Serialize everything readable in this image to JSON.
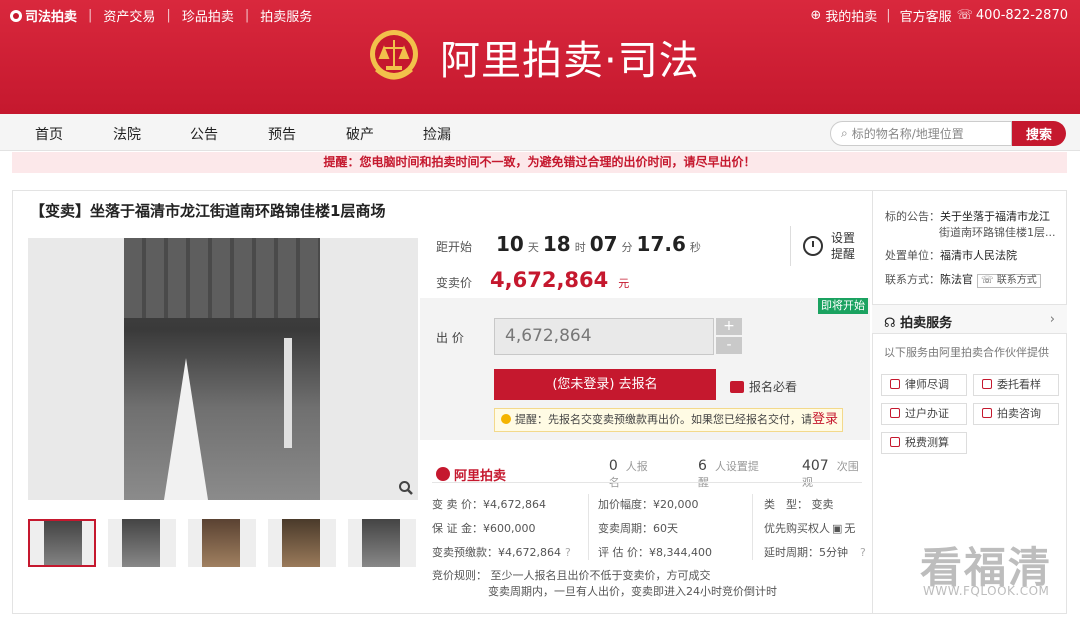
{
  "top": {
    "brand": "司法拍卖",
    "links": [
      "资产交易",
      "珍品拍卖",
      "拍卖服务"
    ],
    "my_auction": "我的拍卖",
    "service": "官方客服",
    "phone": "400-822-2870"
  },
  "logo_text": "阿里拍卖·司法",
  "nav": [
    "首页",
    "法院",
    "公告",
    "预告",
    "破产",
    "捡漏"
  ],
  "search": {
    "placeholder": "标的物名称/地理位置",
    "button": "搜索"
  },
  "notice": "提醒：您电脑时间和拍卖时间不一致，为避免错过合理的出价时间，请尽早出价！",
  "title": "【变卖】坐落于福清市龙江街道南环路锦佳楼1层商场",
  "countdown": {
    "label": "距开始",
    "d": "10",
    "du": "天",
    "h": "18",
    "hu": "时",
    "m": "07",
    "mu": "分",
    "s": "17.6",
    "su": "秒"
  },
  "price": {
    "label": "变卖价",
    "value": "4,672,864",
    "unit": "元"
  },
  "remind": {
    "line1": "设置",
    "line2": "提醒"
  },
  "badge_soon": "即将开始",
  "bid": {
    "label": "出 价",
    "value": "4,672,864",
    "plus": "+",
    "minus": "-"
  },
  "register_button": "(您未登录) 去报名",
  "must_see": "报名必看",
  "tip": {
    "text": "提醒：先报名交变卖预缴款再出价。如果您已经报名交付，请",
    "link": "登录"
  },
  "stats": {
    "logo": "阿里拍卖",
    "signup": {
      "n": "0",
      "label": "人报名"
    },
    "reminders": {
      "n": "6",
      "label": "人设置提醒"
    },
    "views": {
      "n": "407",
      "label": "次围观"
    }
  },
  "details": {
    "col1": [
      "变 卖 价：¥4,672,864",
      "保 证 金：¥600,000",
      "变卖预缴款：¥4,672,864"
    ],
    "col2": [
      "加价幅度：¥20,000",
      "变卖周期：60天",
      "评 估 价：¥8,344,400"
    ],
    "col3": [
      "类　型：  变卖",
      "优先购买权人",
      "延时周期：5分钟"
    ],
    "col3_suffix": "无"
  },
  "rules": {
    "label": "竞价规则：",
    "line1": "至少一人报名且出价不低于变卖价，方可成交",
    "line2": "变卖周期内，一旦有人出价，变卖即进入24小时竞价倒计时"
  },
  "side": {
    "notice_label": "标的公告：",
    "notice_value1": "关于坐落于福清市龙江",
    "notice_value2": "街道南环路锦佳楼1层...",
    "unit_label": "处置单位：",
    "unit_value": "福清市人民法院",
    "contact_label": "联系方式：",
    "contact_value": "陈法官",
    "contact_pill": "联系方式",
    "service_title": "拍卖服务",
    "service_desc": "以下服务由阿里拍卖合作伙伴提供",
    "buttons": [
      "律师尽调",
      "委托看样",
      "过户办证",
      "拍卖咨询",
      "税费测算"
    ]
  },
  "watermark": {
    "big": "看福清",
    "small": "WWW.FQLOOK.COM"
  },
  "colors": {
    "brand_red": "#c5182e",
    "soon_green": "#1aa260"
  }
}
